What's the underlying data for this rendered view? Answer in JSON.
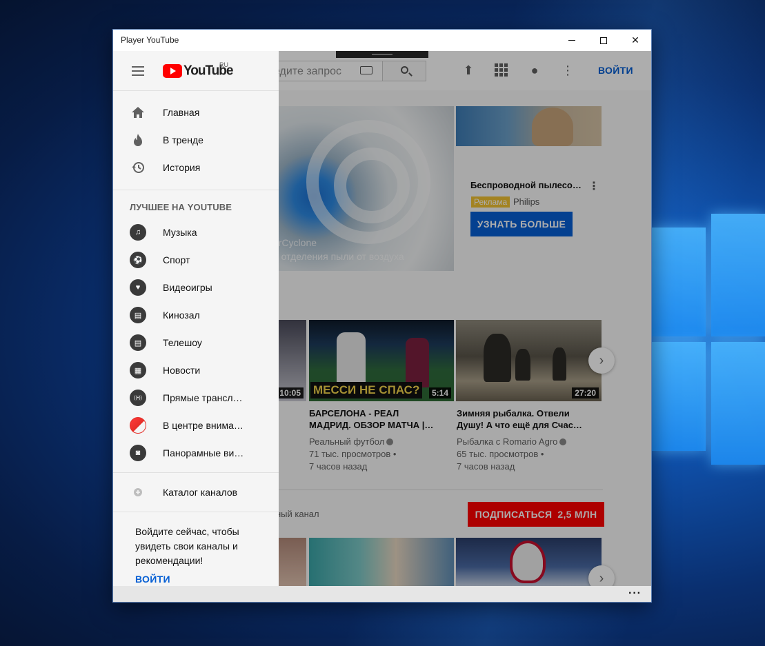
{
  "window": {
    "title": "Player YouTube",
    "min_icon": "minimize-icon",
    "max_icon": "maximize-icon",
    "close_icon": "close-icon",
    "close_glyph": "✕"
  },
  "topbar": {
    "search_placeholder": "едите запрос",
    "signin_label": "ВОЙТИ"
  },
  "hero": {
    "caption_line1": "erCyclone",
    "caption_line2": "о отделения пыли от воздуха"
  },
  "ad": {
    "title": "Беспроводной пылесо…",
    "badge": "Реклама",
    "advertiser": "Philips",
    "cta": "УЗНАТЬ БОЛЬШЕ"
  },
  "videos": [
    {
      "duration": "10:05"
    },
    {
      "banner": "МЕССИ НЕ СПАС?",
      "duration": "5:14",
      "title_line1": "БАРСЕЛОНА - РЕАЛ",
      "title_line2": "МАДРИД. ОБЗОР МАТЧА |…",
      "channel": "Реальный футбол",
      "views": "71 тыс. просмотров •",
      "age": "7 часов назад"
    },
    {
      "duration": "27:20",
      "title_line1": "Зимняя рыбалка. Отвели",
      "title_line2": "Душу! А что ещё для Счас…",
      "channel": "Рыбалка с Romario Agro",
      "views": "65 тыс. просмотров •",
      "age": "7 часов назад"
    }
  ],
  "channel_row": {
    "label": "ный канал",
    "subscribe_label": "ПОДПИСАТЬСЯ",
    "subscribe_count": "2,5 МЛН"
  },
  "drawer": {
    "logo_text": "YouTube",
    "logo_region": "RU",
    "primary": [
      {
        "label": "Главная",
        "icon": "home-icon"
      },
      {
        "label": "В тренде",
        "icon": "flame-icon"
      },
      {
        "label": "История",
        "icon": "history-icon"
      }
    ],
    "section_title": "ЛУЧШЕЕ НА YOUTUBE",
    "best": [
      {
        "label": "Музыка",
        "icon": "music-icon",
        "glyph": "♫"
      },
      {
        "label": "Спорт",
        "icon": "sport-icon",
        "glyph": "⚽"
      },
      {
        "label": "Видеоигры",
        "icon": "gaming-icon",
        "glyph": "♥"
      },
      {
        "label": "Кинозал",
        "icon": "film-icon",
        "glyph": "▤"
      },
      {
        "label": "Телешоу",
        "icon": "tv-show-icon",
        "glyph": "▤"
      },
      {
        "label": "Новости",
        "icon": "news-icon",
        "glyph": "▦"
      },
      {
        "label": "Прямые трансл…",
        "icon": "live-icon",
        "glyph": "((•))"
      },
      {
        "label": "В центре внима…",
        "icon": "spotlight-icon",
        "glyph": ""
      },
      {
        "label": "Панорамные ви…",
        "icon": "vr-icon",
        "glyph": "◙"
      }
    ],
    "catalog": {
      "label": "Каталог каналов",
      "icon": "add-circle-icon"
    },
    "signin_prompt": "Войдите сейчас, чтобы увидеть свои каналы и рекомендации!",
    "signin_link": "ВОЙТИ"
  },
  "bottombar": {
    "more": "···"
  },
  "colors": {
    "brand_red": "#ff0000",
    "link_blue": "#065fd4",
    "ad_badge": "#f1c232"
  }
}
